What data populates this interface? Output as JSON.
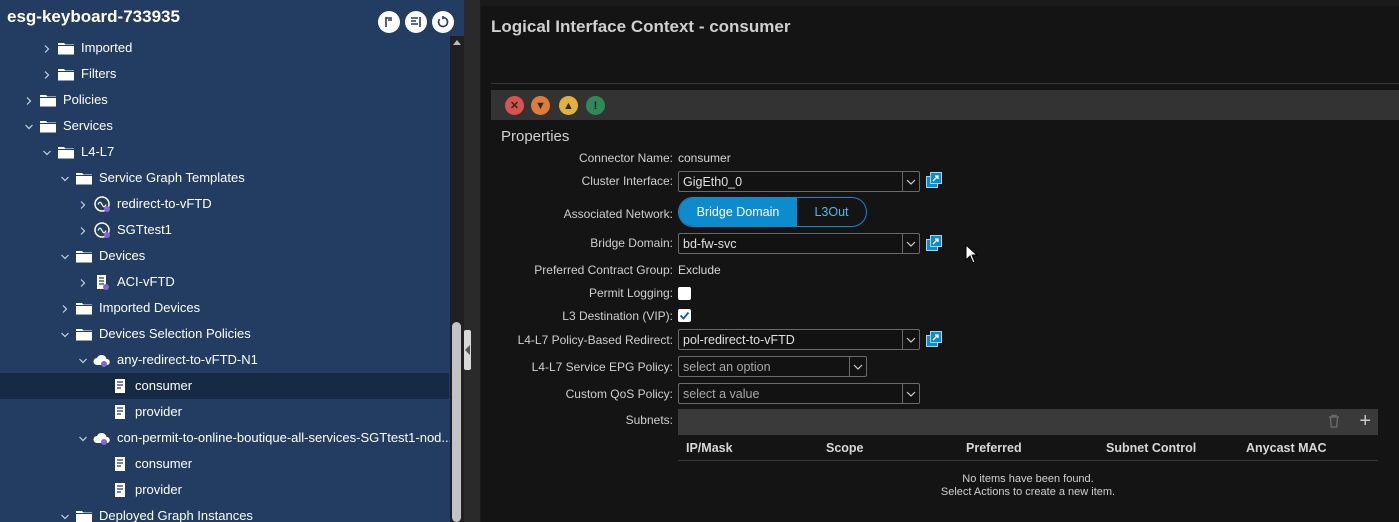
{
  "tree_panel": {
    "title": "esg-keyboard-733935",
    "items": [
      {
        "label": "Imported",
        "icon": "folder-icon",
        "chevron": "right"
      },
      {
        "label": "Filters",
        "icon": "folder-icon",
        "chevron": "right"
      },
      {
        "label": "Policies",
        "icon": "folder-icon",
        "chevron": "right"
      },
      {
        "label": "Services",
        "icon": "folder-icon",
        "chevron": "down"
      },
      {
        "label": "L4-L7",
        "icon": "folder-icon",
        "chevron": "down"
      },
      {
        "label": "Service Graph Templates",
        "icon": "folder-icon",
        "chevron": "down"
      },
      {
        "label": "redirect-to-vFTD",
        "icon": "service-graph-icon",
        "chevron": "right"
      },
      {
        "label": "SGTtest1",
        "icon": "service-graph-icon",
        "chevron": "right"
      },
      {
        "label": "Devices",
        "icon": "folder-icon",
        "chevron": "down"
      },
      {
        "label": "ACI-vFTD",
        "icon": "device-icon",
        "chevron": "right"
      },
      {
        "label": "Imported Devices",
        "icon": "folder-icon",
        "chevron": "right"
      },
      {
        "label": "Devices Selection Policies",
        "icon": "folder-icon",
        "chevron": "down"
      },
      {
        "label": "any-redirect-to-vFTD-N1",
        "icon": "cloud-policy-icon",
        "chevron": "down"
      },
      {
        "label": "consumer",
        "icon": "document-icon",
        "chevron": "none",
        "selected": true
      },
      {
        "label": "provider",
        "icon": "document-icon",
        "chevron": "none"
      },
      {
        "label": "con-permit-to-online-boutique-all-services-SGTtest1-nod...",
        "icon": "cloud-policy-icon",
        "chevron": "down"
      },
      {
        "label": "consumer",
        "icon": "document-icon",
        "chevron": "none"
      },
      {
        "label": "provider",
        "icon": "document-icon",
        "chevron": "none"
      },
      {
        "label": "Deployed Graph Instances",
        "icon": "folder-icon",
        "chevron": "down"
      }
    ]
  },
  "detail": {
    "title": "Logical Interface Context - consumer",
    "properties_heading": "Properties",
    "connector_name": {
      "label": "Connector Name:",
      "value": "consumer"
    },
    "cluster_interface": {
      "label": "Cluster Interface:",
      "value": "GigEth0_0"
    },
    "associated_network": {
      "label": "Associated Network:",
      "options": [
        "Bridge Domain",
        "L3Out"
      ],
      "selected": "Bridge Domain"
    },
    "bridge_domain": {
      "label": "Bridge Domain:",
      "value": "bd-fw-svc"
    },
    "preferred_contract_group": {
      "label": "Preferred Contract Group:",
      "value": "Exclude"
    },
    "permit_logging": {
      "label": "Permit Logging:",
      "checked": false
    },
    "l3_destination": {
      "label": "L3 Destination (VIP):",
      "checked": true
    },
    "pbr": {
      "label": "L4-L7 Policy-Based Redirect:",
      "value": "pol-redirect-to-vFTD"
    },
    "service_epg_policy": {
      "label": "L4-L7 Service EPG Policy:",
      "placeholder": "select an option"
    },
    "custom_qos": {
      "label": "Custom QoS Policy:",
      "placeholder": "select a value"
    },
    "subnets": {
      "label": "Subnets:",
      "columns": [
        "IP/Mask",
        "Scope",
        "Preferred",
        "Subnet Control",
        "Anycast MAC"
      ],
      "empty_line1": "No items have been found.",
      "empty_line2": "Select Actions to create a new item."
    }
  },
  "colors": {
    "tree_bg": "#223d61",
    "selected_row": "#162a45",
    "accent": "#0d8ccd",
    "panel_bg": "#141414"
  }
}
